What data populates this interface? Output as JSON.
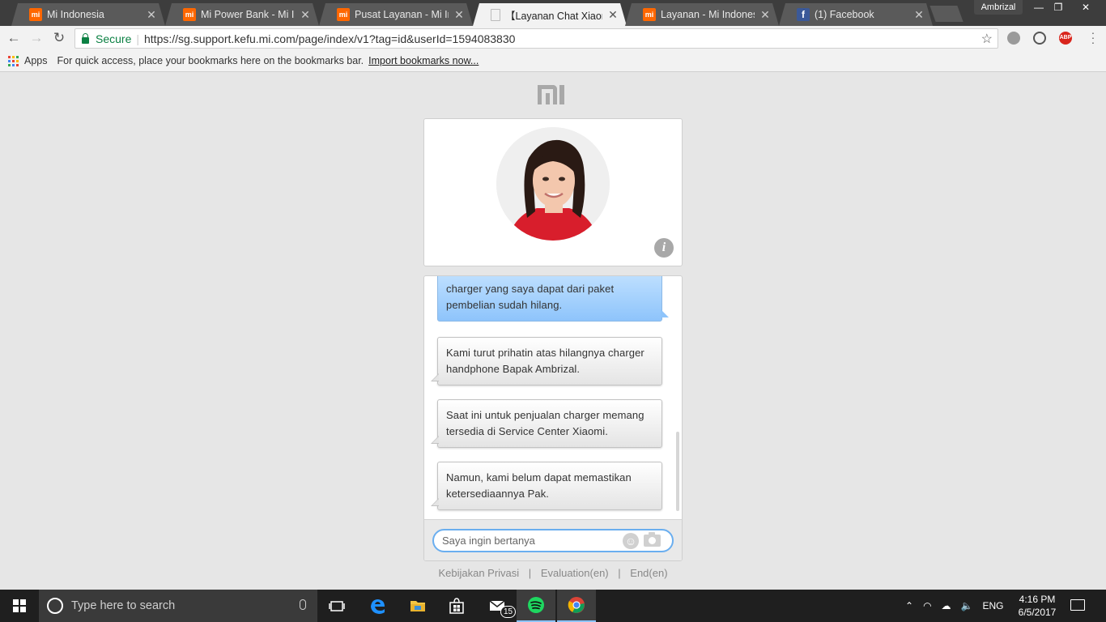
{
  "browser": {
    "tabs": [
      {
        "title": "Mi Indonesia",
        "icon": "mi-icon",
        "active": false
      },
      {
        "title": "Mi Power Bank - Mi Indonesia",
        "icon": "mi-icon",
        "active": false
      },
      {
        "title": "Pusat Layanan - Mi Indonesia",
        "icon": "mi-icon",
        "active": false
      },
      {
        "title": "【Layanan Chat Xiaomi】",
        "icon": "document-icon",
        "active": true
      },
      {
        "title": "Layanan - Mi Indonesia",
        "icon": "mi-icon",
        "active": false
      },
      {
        "title": "(1) Facebook",
        "icon": "facebook-icon",
        "active": false
      }
    ],
    "profile_name": "Ambrizal",
    "secure_label": "Secure",
    "url": "https://sg.support.kefu.mi.com/page/index/v1?tag=id&userId=1594083830",
    "bookmarks_bar": {
      "apps_label": "Apps",
      "hint": "For quick access, place your bookmarks here on the bookmarks bar.",
      "import_link": "Import bookmarks now..."
    }
  },
  "chat": {
    "messages": [
      {
        "sender": "user",
        "text": "charger yang saya dapat dari paket pembelian sudah hilang."
      },
      {
        "sender": "agent",
        "text": "Kami turut prihatin atas hilangnya charger handphone Bapak Ambrizal."
      },
      {
        "sender": "agent",
        "text": "Saat ini untuk penjualan charger memang tersedia di Service Center Xiaomi."
      },
      {
        "sender": "agent",
        "text": "Namun, kami belum dapat memastikan ketersediaannya Pak."
      }
    ],
    "input_placeholder": "Saya ingin bertanya",
    "footer_links": {
      "privacy": "Kebijakan Privasi",
      "separator": "|",
      "evaluation": "Evaluation(en)",
      "end": "End(en)"
    }
  },
  "taskbar": {
    "search_placeholder": "Type here to search",
    "mail_badge": "15",
    "language": "ENG",
    "time": "4:16 PM",
    "date": "6/5/2017"
  },
  "colors": {
    "mi_orange": "#ff6700",
    "user_bubble": "#8ec4fb",
    "input_border": "#6aaeef"
  }
}
